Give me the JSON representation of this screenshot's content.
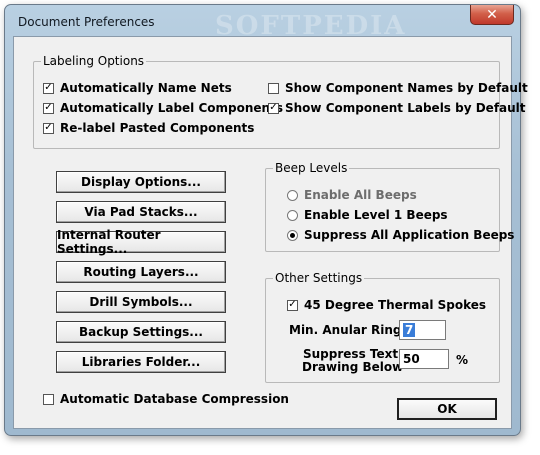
{
  "window": {
    "title": "Document Preferences",
    "watermark": "SOFTPEDIA",
    "close_glyph": "✕"
  },
  "labeling": {
    "legend": "Labeling Options",
    "options": [
      {
        "label": "Automatically Name Nets",
        "checked": true
      },
      {
        "label": "Automatically Label Components",
        "checked": true
      },
      {
        "label": "Re-label Pasted Components",
        "checked": true
      },
      {
        "label": "Show Component Names by Default",
        "checked": false
      },
      {
        "label": "Show Component Labels by Default",
        "checked": true
      }
    ]
  },
  "buttons": [
    "Display Options...",
    "Via Pad Stacks...",
    "Internal Router Settings...",
    "Routing Layers...",
    "Drill Symbols...",
    "Backup Settings...",
    "Libraries Folder..."
  ],
  "beep": {
    "legend": "Beep Levels",
    "options": [
      {
        "label": "Enable All Beeps",
        "selected": false
      },
      {
        "label": "Enable Level 1 Beeps",
        "selected": false
      },
      {
        "label": "Suppress All Application Beeps",
        "selected": true
      }
    ]
  },
  "other": {
    "legend": "Other Settings",
    "thermal_label": "45 Degree Thermal Spokes",
    "thermal_checked": true,
    "anular_label": "Min. Anular Ring:",
    "anular_value": "7",
    "suppress_label_1": "Suppress Text",
    "suppress_label_2": "Drawing Below",
    "suppress_value": "50",
    "suppress_unit": "%"
  },
  "compression": {
    "label": "Automatic Database Compression",
    "checked": false
  },
  "ok_label": "OK"
}
